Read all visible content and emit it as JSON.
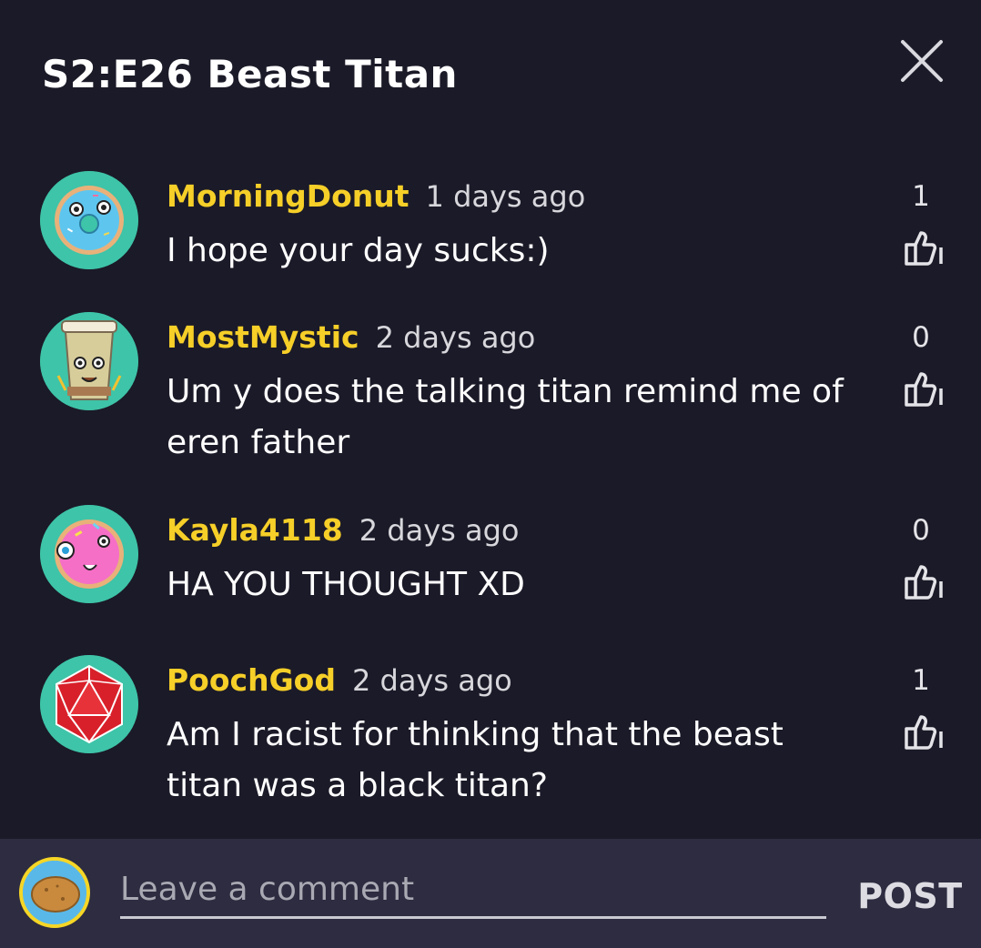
{
  "header": {
    "title": "S2:E26 Beast Titan",
    "close_icon": "close-icon"
  },
  "colors": {
    "background": "#1b1a28",
    "username": "#f6cf28",
    "avatar_bg": "#3ec4a8",
    "footer": "#2d2c41"
  },
  "comments": [
    {
      "username": "MorningDonut",
      "time": "1 days ago",
      "text": "I hope your day sucks:)",
      "likes": "1",
      "avatar_icon": "donut-avatar-icon"
    },
    {
      "username": "MostMystic",
      "time": "2 days ago",
      "text": "Um y does the talking titan remind me of eren father",
      "likes": "0",
      "avatar_icon": "coffee-cup-avatar-icon"
    },
    {
      "username": "Kayla4118",
      "time": "2 days ago",
      "text": "HA YOU THOUGHT XD",
      "likes": "0",
      "avatar_icon": "pink-donut-avatar-icon"
    },
    {
      "username": "PoochGod",
      "time": "2 days ago",
      "text": "Am I racist for thinking that the beast titan was a black titan?",
      "likes": "1",
      "avatar_icon": "d20-dice-avatar-icon"
    }
  ],
  "footer": {
    "placeholder": "Leave a comment",
    "post_label": "POST",
    "avatar_icon": "potato-avatar-icon"
  }
}
